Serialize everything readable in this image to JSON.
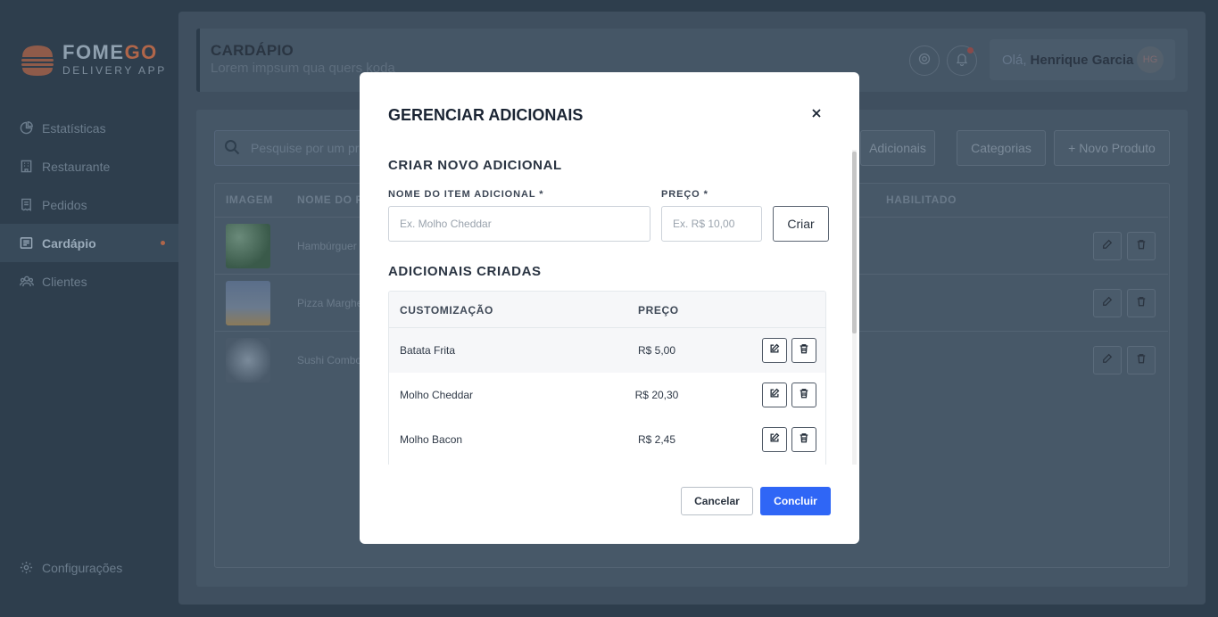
{
  "app": {
    "brand_part1": "FOME",
    "brand_part2": "GO",
    "tagline": "DELIVERY APP"
  },
  "sidebar": {
    "items": [
      {
        "label": "Estatísticas",
        "icon": "pie-chart-icon",
        "active": false
      },
      {
        "label": "Restaurante",
        "icon": "building-icon",
        "active": false
      },
      {
        "label": "Pedidos",
        "icon": "receipt-icon",
        "active": false
      },
      {
        "label": "Cardápio",
        "icon": "menu-book-icon",
        "active": true
      },
      {
        "label": "Clientes",
        "icon": "users-icon",
        "active": false
      }
    ],
    "config_label": "Configurações"
  },
  "header": {
    "title": "CARDÁPIO",
    "subtitle": "Lorem impsum qua quers koda",
    "greeting": "Olá,",
    "user_name": "Henrique Garcia",
    "user_initials": "HG"
  },
  "toolbar": {
    "search_placeholder": "Pesquise por um pr",
    "btn_adicionais": "Adicionais",
    "btn_categorias": "Categorias",
    "btn_novo_produto": "+ Novo Produto"
  },
  "products_table": {
    "col_imagem": "IMAGEM",
    "col_nome": "NOME DO P",
    "col_habilitado": "HABILITADO",
    "rows": [
      {
        "name": "Hambúrguer"
      },
      {
        "name": "Pizza Marghe"
      },
      {
        "name": "Sushi Combo"
      }
    ]
  },
  "modal": {
    "title": "GERENCIAR ADICIONAIS",
    "create_section_title": "CRIAR NOVO ADICIONAL",
    "name_label": "NOME DO ITEM ADICIONAL *",
    "name_placeholder": "Ex. Molho Cheddar",
    "price_label": "PREÇO *",
    "price_placeholder": "Ex. R$ 10,00",
    "create_button": "Criar",
    "list_section_title": "ADICIONAIS CRIADAS",
    "col_customizacao": "CUSTOMIZAÇÃO",
    "col_preco": "PREÇO",
    "rows": [
      {
        "name": "Batata Frita",
        "price": "R$ 5,00"
      },
      {
        "name": "Molho Cheddar",
        "price": "R$ 20,30"
      },
      {
        "name": "Molho Bacon",
        "price": "R$ 2,45"
      }
    ],
    "cancel_button": "Cancelar",
    "confirm_button": "Concluir"
  },
  "colors": {
    "accent": "#2f66f6",
    "brand_orange": "#b0664a",
    "sidebar_bg": "#2e3e4d"
  }
}
